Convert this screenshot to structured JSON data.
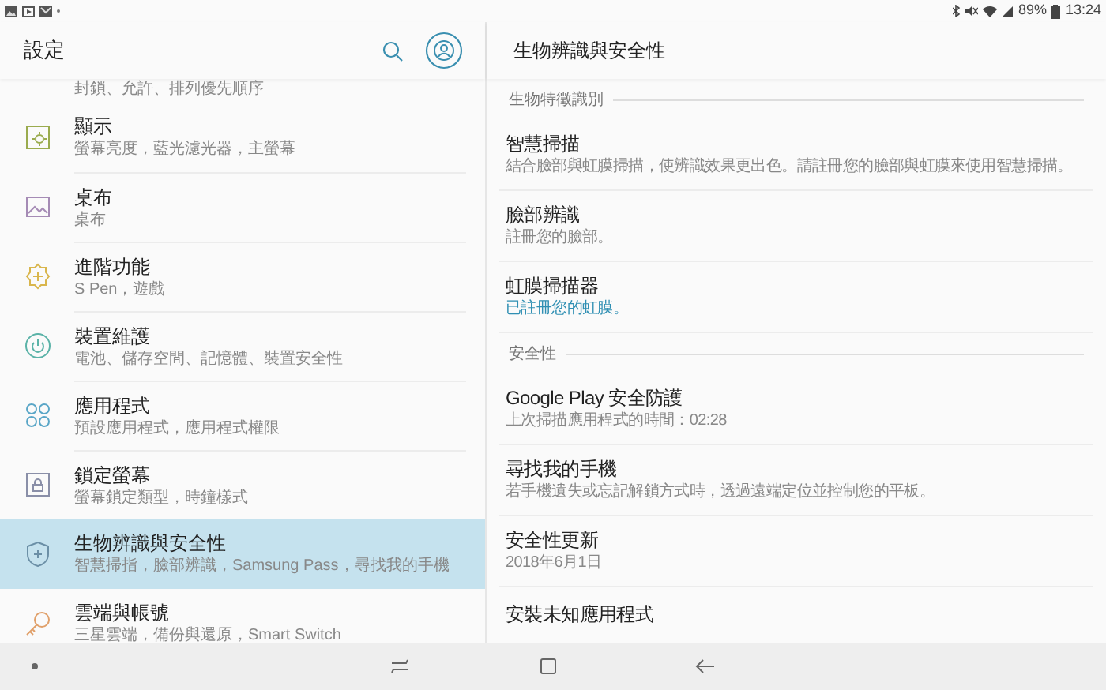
{
  "status_bar": {
    "battery": "89%",
    "time": "13:24"
  },
  "left_panel": {
    "title": "設定",
    "partial_summary": "封鎖、允許、排列優先順序",
    "items": [
      {
        "title": "顯示",
        "summary": "螢幕亮度，藍光濾光器，主螢幕",
        "selected": false
      },
      {
        "title": "桌布",
        "summary": "桌布",
        "selected": false
      },
      {
        "title": "進階功能",
        "summary": "S Pen，遊戲",
        "selected": false
      },
      {
        "title": "裝置維護",
        "summary": "電池、儲存空間、記憶體、裝置安全性",
        "selected": false
      },
      {
        "title": "應用程式",
        "summary": "預設應用程式，應用程式權限",
        "selected": false
      },
      {
        "title": "鎖定螢幕",
        "summary": "螢幕鎖定類型，時鐘樣式",
        "selected": false
      },
      {
        "title": "生物辨識與安全性",
        "summary": "智慧掃指，臉部辨識，Samsung Pass，尋找我的手機",
        "selected": true
      },
      {
        "title": "雲端與帳號",
        "summary": "三星雲端，備份與還原，Smart Switch",
        "selected": false
      }
    ]
  },
  "right_panel": {
    "title": "生物辨識與安全性",
    "sections": [
      {
        "header": "生物特徵識別",
        "items": [
          {
            "title": "智慧掃描",
            "summary": "結合臉部與虹膜掃描，使辨識效果更出色。請註冊您的臉部與虹膜來使用智慧掃描。"
          },
          {
            "title": "臉部辨識",
            "summary": "註冊您的臉部。"
          },
          {
            "title": "虹膜掃描器",
            "status": "已註冊您的虹膜。"
          }
        ]
      },
      {
        "header": "安全性",
        "items": [
          {
            "title": "Google Play 安全防護",
            "summary": "上次掃描應用程式的時間：02:28"
          },
          {
            "title": "尋找我的手機",
            "summary": "若手機遺失或忘記解鎖方式時，透過遠端定位並控制您的平板。"
          },
          {
            "title": "安全性更新",
            "summary": "2018年6月1日"
          },
          {
            "title": "安裝未知應用程式"
          }
        ]
      }
    ]
  }
}
